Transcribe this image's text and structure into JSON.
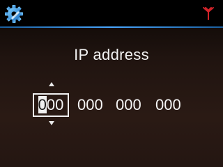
{
  "header": {
    "settings_icon": "gear-icon",
    "signal_icon": "antenna-signal-icon",
    "accent_color": "#3a9bff",
    "signal_color": "#d4242a"
  },
  "title": "IP address",
  "ip_fields": {
    "octet1_cursor": "0",
    "octet1_rest": "00",
    "octet2": "000",
    "octet3": "000",
    "octet4": "000"
  },
  "controls": {
    "increment_icon": "arrow-up-icon",
    "decrement_icon": "arrow-down-icon"
  }
}
